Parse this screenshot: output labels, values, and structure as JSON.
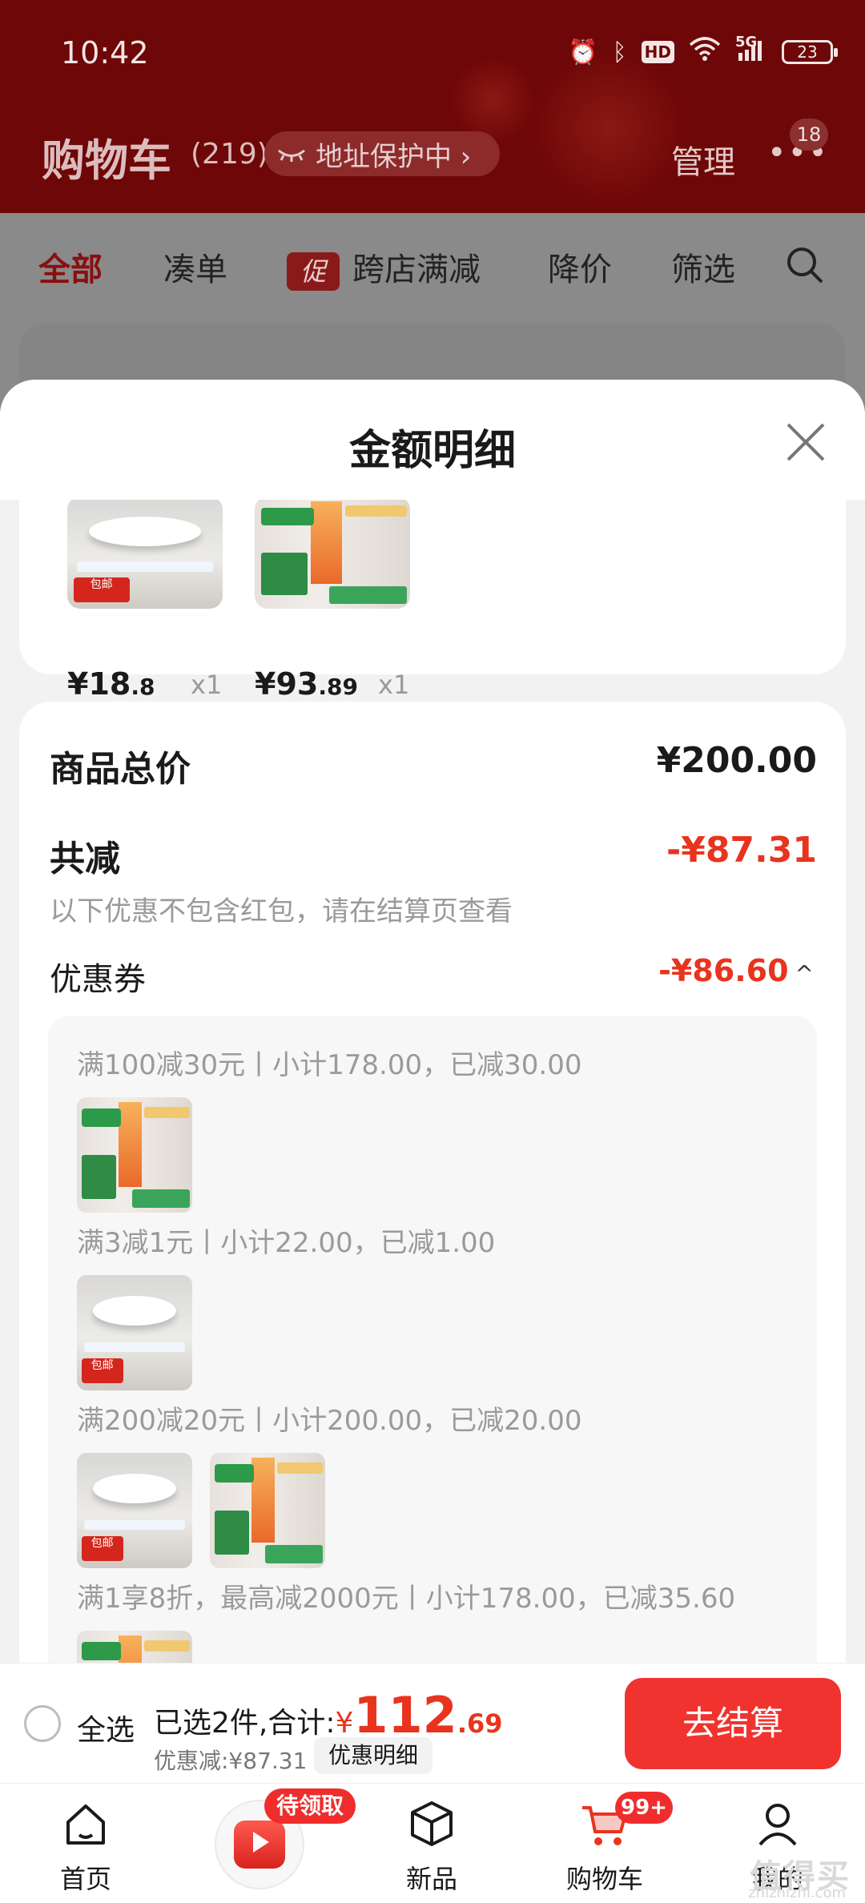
{
  "status_bar": {
    "time": "10:42",
    "network": "5G",
    "hd": "HD",
    "battery": "23"
  },
  "header": {
    "title": "购物车",
    "count": "(219)",
    "address_protect": "地址保护中 ›",
    "manage": "管理",
    "more": "•••",
    "more_badge": "18"
  },
  "filter_tabs": {
    "all": "全部",
    "combine": "凑单",
    "promo_tag": "促",
    "cross_store": "跨店满减",
    "price_drop": "降价",
    "filter": "筛选"
  },
  "sheet": {
    "title": "金额明细",
    "products": [
      {
        "price_main": "¥18",
        "price_dec": ".8",
        "qty": "x1",
        "image": "ceiling-lamp"
      },
      {
        "price_main": "¥93",
        "price_dec": ".89",
        "qty": "x1",
        "image": "heater"
      }
    ],
    "total_label": "商品总价",
    "total_value": "¥200.00",
    "reduce_label": "共减",
    "reduce_value": "-¥87.31",
    "note": "以下优惠不包含红包，请在结算页查看",
    "coupon_label": "优惠券",
    "coupon_value": "-¥86.60",
    "coupon_chevron": "^",
    "rules": [
      {
        "text": "满100减30元丨小计178.00，已减30.00",
        "items": [
          "heater"
        ]
      },
      {
        "text": "满3减1元丨小计22.00，已减1.00",
        "items": [
          "ceiling-lamp"
        ]
      },
      {
        "text": "满200减20元丨小计200.00，已减20.00",
        "items": [
          "ceiling-lamp",
          "heater"
        ]
      },
      {
        "text": "满1享8折，最高减2000元丨小计178.00，已减35.60",
        "items": [
          "heater"
        ]
      }
    ]
  },
  "checkout": {
    "select_all": "全选",
    "summary_prefix": "已选2件,合计:",
    "currency": "¥",
    "total_int": "112",
    "total_dec": ".69",
    "discount_line": "优惠减:¥87.31",
    "detail_button": "优惠明细",
    "go_button": "去结算"
  },
  "tabbar": {
    "home": "首页",
    "center_badge": "待领取",
    "new": "新品",
    "cart": "购物车",
    "cart_badge": "99+",
    "me": "我的"
  },
  "watermark": {
    "main": "值得买",
    "sub": "zhizhizhi.com"
  },
  "colors": {
    "accent_red": "#e8341e",
    "checkout_red": "#f0332f",
    "header_red_dimmed": "#6e0707"
  }
}
